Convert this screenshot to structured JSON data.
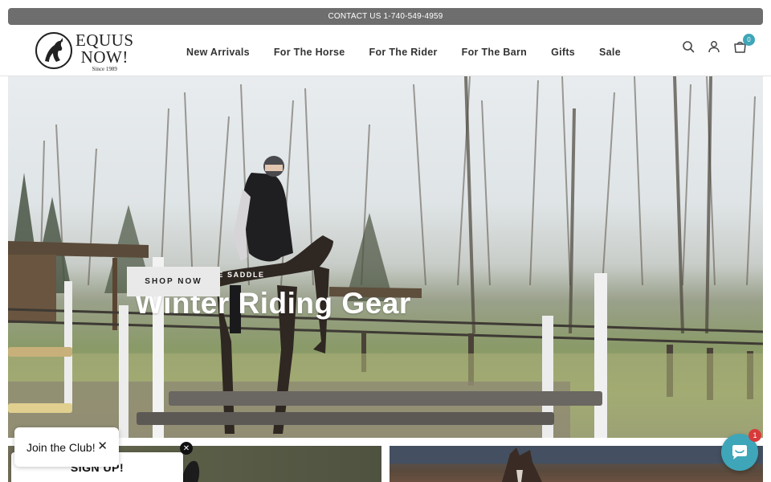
{
  "announcement": {
    "text": "CONTACT US 1-740-549-4959"
  },
  "logo": {
    "line1": "EQUUS",
    "line2": "NOW!",
    "line3": "Since 1989"
  },
  "nav": {
    "items": [
      "New Arrivals",
      "For The Horse",
      "For The Rider",
      "For The Barn",
      "Gifts",
      "Sale"
    ]
  },
  "header_icons": {
    "search": "search-icon",
    "account": "user-icon",
    "cart": "cart-icon",
    "cart_count": "0"
  },
  "hero": {
    "eyebrow": "STAY WARM IN THE SADDLE",
    "title": "Winter Riding Gear",
    "cta": "SHOP NOW"
  },
  "popup": {
    "join_text": "Join the Club!",
    "close_symbol": "✕",
    "signup_text": "SIGN UP!",
    "signup_close": "✕"
  },
  "chat": {
    "badge": "1",
    "icon": "chat-icon"
  },
  "colors": {
    "accent": "#3ea6b8",
    "announce_bg": "#6e6e6e",
    "badge_red": "#d83a3a"
  }
}
